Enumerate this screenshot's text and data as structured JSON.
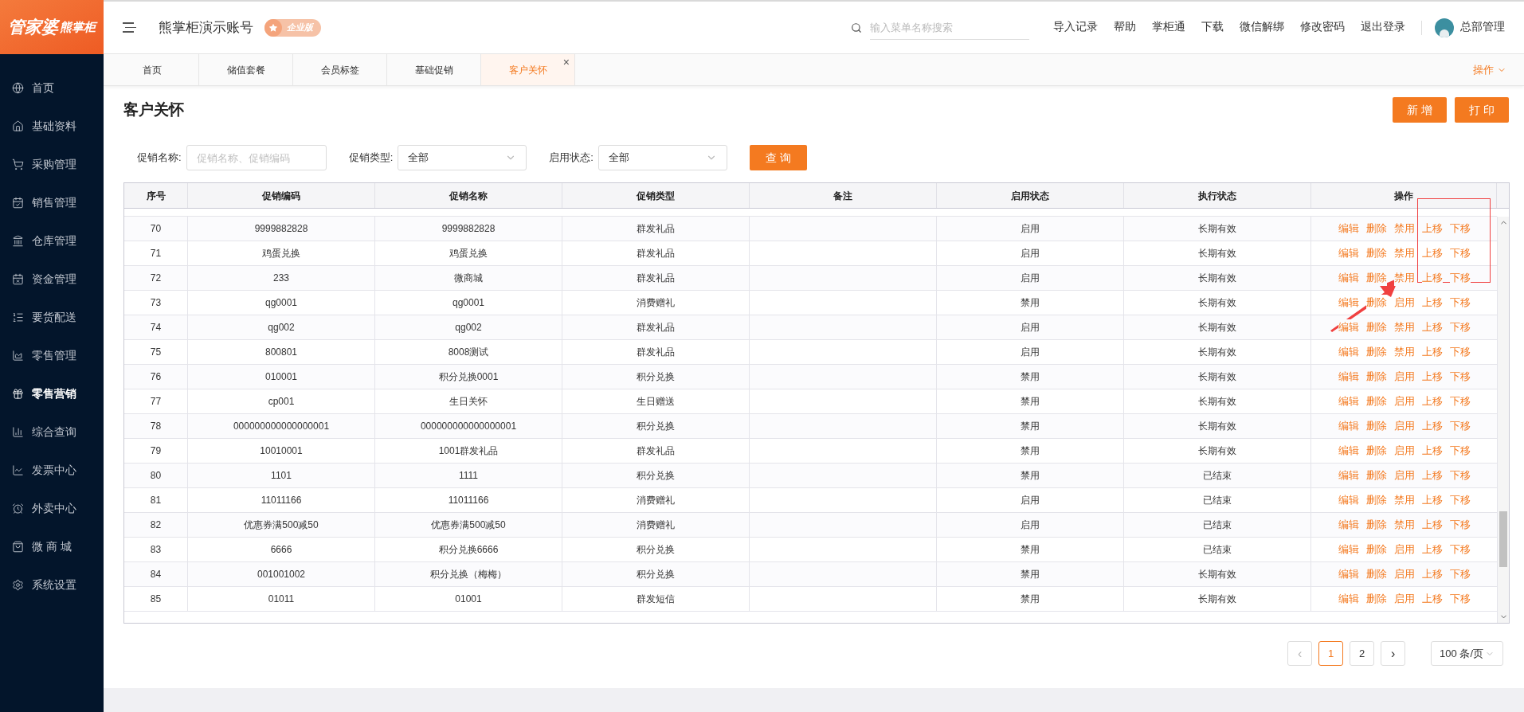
{
  "logo": {
    "main": "管家婆",
    "sub": "熊掌柜"
  },
  "header": {
    "account": "熊掌柜演示账号",
    "badge": "企业版",
    "search": {
      "placeholder": "输入菜单名称搜索"
    },
    "links": [
      "导入记录",
      "帮助",
      "掌柜通",
      "下载",
      "微信解绑",
      "修改密码",
      "退出登录"
    ],
    "user": "总部管理"
  },
  "sidebar": {
    "items": [
      {
        "label": "首页",
        "selected": false
      },
      {
        "label": "基础资料",
        "selected": false
      },
      {
        "label": "采购管理",
        "selected": false
      },
      {
        "label": "销售管理",
        "selected": false
      },
      {
        "label": "仓库管理",
        "selected": false
      },
      {
        "label": "资金管理",
        "selected": false
      },
      {
        "label": "要货配送",
        "selected": false
      },
      {
        "label": "零售管理",
        "selected": false
      },
      {
        "label": "零售营销",
        "selected": true
      },
      {
        "label": "综合查询",
        "selected": false
      },
      {
        "label": "发票中心",
        "selected": false
      },
      {
        "label": "外卖中心",
        "selected": false
      },
      {
        "label": "微 商 城",
        "selected": false
      },
      {
        "label": "系统设置",
        "selected": false
      }
    ]
  },
  "tabs": [
    {
      "label": "首页",
      "selected": false
    },
    {
      "label": "储值套餐",
      "selected": false
    },
    {
      "label": "会员标签",
      "selected": false
    },
    {
      "label": "基础促销",
      "selected": false
    },
    {
      "label": "客户关怀",
      "selected": true,
      "close": "×"
    }
  ],
  "tab_menu": "操作",
  "page": {
    "title": "客户关怀",
    "buttons": [
      "新 增",
      "打 印"
    ]
  },
  "filters": [
    {
      "kind": "input",
      "label": "促销名称:",
      "placeholder": "促销名称、促销编码"
    },
    {
      "kind": "select",
      "label": "促销类型:",
      "value": "全部"
    },
    {
      "kind": "select",
      "label": "启用状态:",
      "value": "全部"
    }
  ],
  "query_button": "查 询",
  "table": {
    "columns": [
      "序号",
      "促销编码",
      "促销名称",
      "促销类型",
      "备注",
      "启用状态",
      "执行状态",
      "操作"
    ],
    "rows": [
      {
        "no": "70",
        "code": "9999882828",
        "name": "9999882828",
        "type": "群发礼品",
        "enabled": "启用",
        "exec": "长期有效",
        "actions": [
          "编辑",
          "删除",
          "禁用",
          "上移",
          "下移"
        ]
      },
      {
        "no": "71",
        "code": "鸡蛋兑换",
        "name": "鸡蛋兑换",
        "type": "群发礼品",
        "enabled": "启用",
        "exec": "长期有效",
        "actions": [
          "编辑",
          "删除",
          "禁用",
          "上移",
          "下移"
        ]
      },
      {
        "no": "72",
        "code": "233",
        "name": "微商城",
        "type": "群发礼品",
        "enabled": "启用",
        "exec": "长期有效",
        "actions": [
          "编辑",
          "删除",
          "禁用",
          "上移",
          "下移"
        ]
      },
      {
        "no": "73",
        "code": "qg0001",
        "name": "qg0001",
        "type": "消费赠礼",
        "enabled": "禁用",
        "exec": "长期有效",
        "actions": [
          "编辑",
          "删除",
          "启用",
          "上移",
          "下移"
        ]
      },
      {
        "no": "74",
        "code": "qg002",
        "name": "qg002",
        "type": "群发礼品",
        "enabled": "启用",
        "exec": "长期有效",
        "actions": [
          "编辑",
          "删除",
          "禁用",
          "上移",
          "下移"
        ]
      },
      {
        "no": "75",
        "code": "800801",
        "name": "8008测试",
        "type": "群发礼品",
        "enabled": "启用",
        "exec": "长期有效",
        "actions": [
          "编辑",
          "删除",
          "禁用",
          "上移",
          "下移"
        ]
      },
      {
        "no": "76",
        "code": "010001",
        "name": "积分兑换0001",
        "type": "积分兑换",
        "enabled": "禁用",
        "exec": "长期有效",
        "actions": [
          "编辑",
          "删除",
          "启用",
          "上移",
          "下移"
        ]
      },
      {
        "no": "77",
        "code": "cp001",
        "name": "生日关怀",
        "type": "生日赠送",
        "enabled": "禁用",
        "exec": "长期有效",
        "actions": [
          "编辑",
          "删除",
          "启用",
          "上移",
          "下移"
        ]
      },
      {
        "no": "78",
        "code": "000000000000000001",
        "name": "000000000000000001",
        "type": "积分兑换",
        "enabled": "禁用",
        "exec": "长期有效",
        "actions": [
          "编辑",
          "删除",
          "启用",
          "上移",
          "下移"
        ]
      },
      {
        "no": "79",
        "code": "10010001",
        "name": "1001群发礼品",
        "type": "群发礼品",
        "enabled": "禁用",
        "exec": "长期有效",
        "actions": [
          "编辑",
          "删除",
          "启用",
          "上移",
          "下移"
        ]
      },
      {
        "no": "80",
        "code": "1101",
        "name": "1111",
        "type": "积分兑换",
        "enabled": "禁用",
        "exec": "已结束",
        "actions": [
          "编辑",
          "删除",
          "启用",
          "上移",
          "下移"
        ]
      },
      {
        "no": "81",
        "code": "11011166",
        "name": "11011166",
        "type": "消费赠礼",
        "enabled": "启用",
        "exec": "已结束",
        "actions": [
          "编辑",
          "删除",
          "禁用",
          "上移",
          "下移"
        ]
      },
      {
        "no": "82",
        "code": "优惠券满500减50",
        "name": "优惠券满500减50",
        "type": "消费赠礼",
        "enabled": "启用",
        "exec": "已结束",
        "actions": [
          "编辑",
          "删除",
          "禁用",
          "上移",
          "下移"
        ]
      },
      {
        "no": "83",
        "code": "6666",
        "name": "积分兑换6666",
        "type": "积分兑换",
        "enabled": "禁用",
        "exec": "已结束",
        "actions": [
          "编辑",
          "删除",
          "启用",
          "上移",
          "下移"
        ]
      },
      {
        "no": "84",
        "code": "001001002",
        "name": "积分兑换（梅梅）",
        "type": "积分兑换",
        "enabled": "禁用",
        "exec": "长期有效",
        "actions": [
          "编辑",
          "删除",
          "启用",
          "上移",
          "下移"
        ]
      },
      {
        "no": "85",
        "code": "01011",
        "name": "01001",
        "type": "群发短信",
        "enabled": "禁用",
        "exec": "长期有效",
        "actions": [
          "编辑",
          "删除",
          "启用",
          "上移",
          "下移"
        ]
      }
    ]
  },
  "pagination": {
    "prev": "‹",
    "pages": [
      {
        "label": "1",
        "selected": true
      },
      {
        "label": "2",
        "selected": false
      }
    ],
    "next": "›",
    "page_size": "100 条/页"
  }
}
